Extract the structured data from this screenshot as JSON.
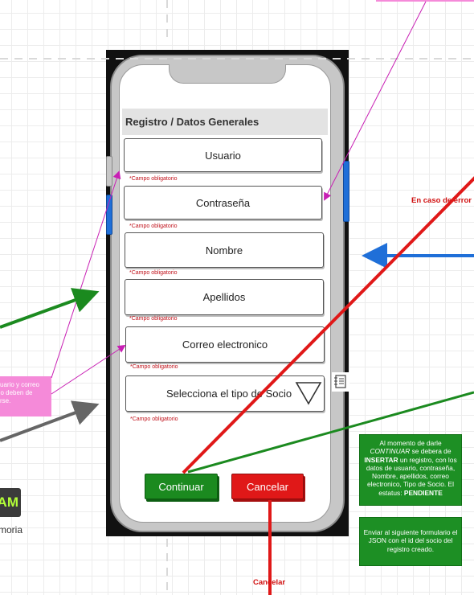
{
  "form": {
    "title": "Registro / Datos Generales",
    "fields": [
      {
        "label": "Usuario",
        "required": "*Campo obligatorio"
      },
      {
        "label": "Contraseña",
        "required": "*Campo obligatorio"
      },
      {
        "label": "Nombre",
        "required": "*Campo obligatorio"
      },
      {
        "label": "Apellidos",
        "required": "*Campo obligatorio"
      },
      {
        "label": "Correo electronico",
        "required": "*Campo obligatorio"
      }
    ],
    "select": {
      "label": "Selecciona el tipo de Socio",
      "required": "*Campo obligatorio"
    },
    "buttons": {
      "continue": "Continuar",
      "cancel": "Cancelar"
    }
  },
  "labels": {
    "error": "En caso de error",
    "cancel": "Cancelar"
  },
  "notes": {
    "insert_note": {
      "p1": "Al momento de darle ",
      "p2": "CONTINUAR",
      "p3": " se debera de ",
      "p4": "INSERTAR",
      "p5": " un registro, con los datos de usuario, contraseña, Nombre, apellidos, correo electronico, Tipo de Socio. El estatus: ",
      "p6": "PENDIENTE"
    },
    "json_note": "Enviar al siguiente formulario el JSON con el id del socio del registro creado.",
    "pink_note_lines": [
      "suario y correo",
      "no deben de",
      "tirse."
    ]
  },
  "logo": {
    "text": "AM",
    "caption": "moria"
  },
  "colors": {
    "green": "#1b8a1f",
    "red": "#e01818",
    "blue": "#1f6fd8",
    "magenta": "#c81fb4",
    "pink": "#f58ad9"
  }
}
